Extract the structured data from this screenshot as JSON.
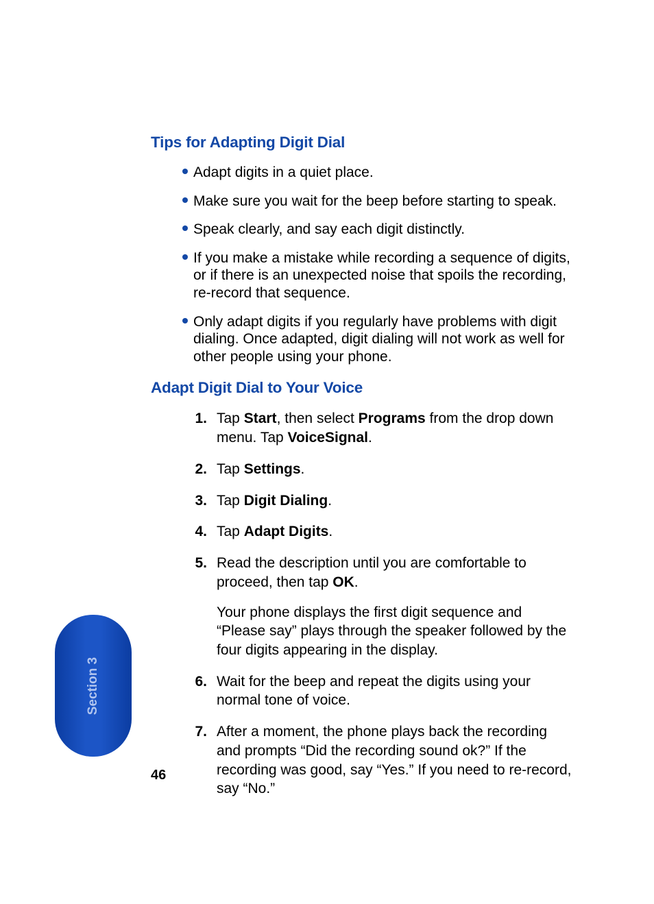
{
  "headings": {
    "tips": "Tips for Adapting Digit Dial",
    "adapt": "Adapt Digit Dial to Your Voice"
  },
  "bullets": [
    "Adapt digits in a quiet place.",
    "Make sure you wait for the beep before starting to speak.",
    "Speak clearly, and say each digit distinctly.",
    "If you make a mistake while recording a sequence of digits, or if there is an unexpected noise that spoils the recording, re-record that sequence.",
    "Only adapt digits if you regularly have problems with digit dialing. Once adapted, digit dialing will not work as well for other people using your phone."
  ],
  "steps": {
    "s1": {
      "num": "1.",
      "a": "Tap ",
      "b1": "Start",
      "c": ", then select ",
      "b2": "Programs",
      "d": " from the drop down menu. Tap ",
      "b3": "VoiceSignal",
      "e": "."
    },
    "s2": {
      "num": "2.",
      "a": "Tap ",
      "b1": "Settings",
      "e": "."
    },
    "s3": {
      "num": "3.",
      "a": "Tap ",
      "b1": "Digit Dialing",
      "e": "."
    },
    "s4": {
      "num": "4.",
      "a": "Tap ",
      "b1": "Adapt Digits",
      "e": "."
    },
    "s5": {
      "num": "5.",
      "a": "Read the description until you are comfortable to proceed, then tap ",
      "b1": "OK",
      "e": ".",
      "para": "Your phone displays the first digit sequence and “Please say” plays through the speaker followed by the four digits appearing in the display."
    },
    "s6": {
      "num": "6.",
      "text": "Wait for the beep and repeat the digits using your normal tone of voice."
    },
    "s7": {
      "num": "7.",
      "text": "After a moment, the phone plays back the recording and prompts “Did the recording sound ok?” If the recording was good, say “Yes.” If you need to re-record, say “No.”"
    }
  },
  "tab": {
    "label": "Section 3"
  },
  "page_number": "46"
}
